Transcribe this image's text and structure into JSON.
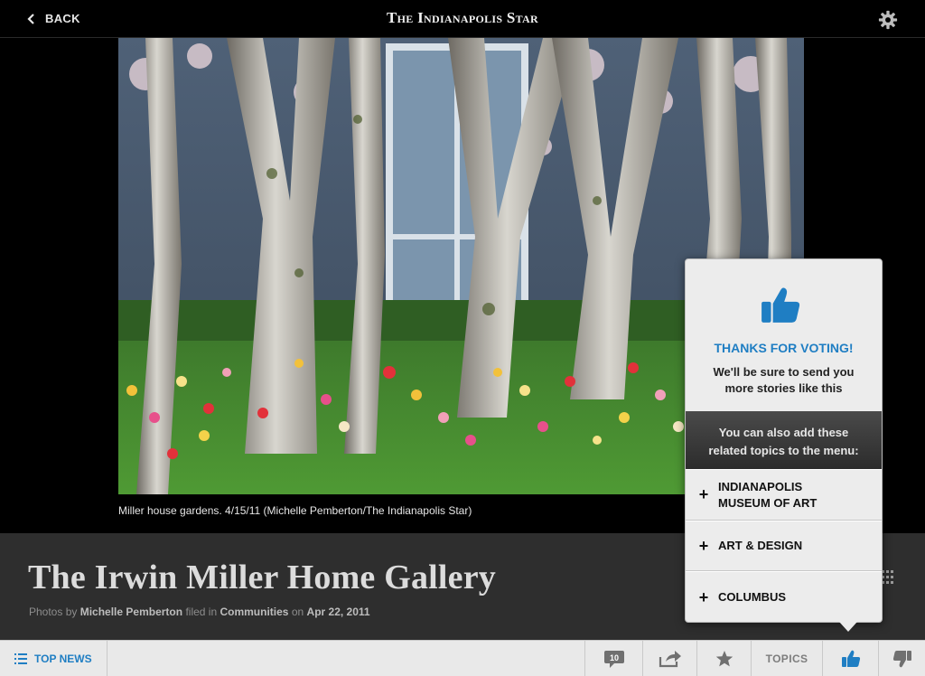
{
  "header": {
    "back_label": "BACK",
    "masthead": "The Indianapolis Star"
  },
  "photo": {
    "caption": "Miller house gardens. 4/15/11 (Michelle Pemberton/The Indianapolis Star)"
  },
  "article": {
    "title": "The Irwin Miller Home Gallery",
    "byline": {
      "prefix": "Photos by",
      "author": "Michelle Pemberton",
      "filed_in": "filed in",
      "section": "Communities",
      "on": "on",
      "date": "Apr 22, 2011"
    }
  },
  "popover": {
    "thanks": "THANKS FOR VOTING!",
    "message_line1": "We'll be sure to send you",
    "message_line2": "more stories like this",
    "also_line1": "You can also add these",
    "also_line2": "related topics to the menu:",
    "topics": [
      {
        "line1": "INDIANAPOLIS",
        "line2": "MUSEUM OF ART"
      },
      {
        "line1": "ART & DESIGN",
        "line2": ""
      },
      {
        "line1": "COLUMBUS",
        "line2": ""
      }
    ]
  },
  "toolbar": {
    "top_news_label": "TOP NEWS",
    "comment_count": "10",
    "topics_label": "TOPICS"
  },
  "colors": {
    "accent": "#1f7ec3",
    "bar": "#e9e9e9",
    "band": "#2e2e2e"
  },
  "icons": [
    "chevron-left-icon",
    "gear-icon",
    "grid-icon",
    "list-icon",
    "comment-icon",
    "share-icon",
    "star-icon",
    "thumbs-up-icon",
    "thumbs-down-icon",
    "plus-icon"
  ]
}
